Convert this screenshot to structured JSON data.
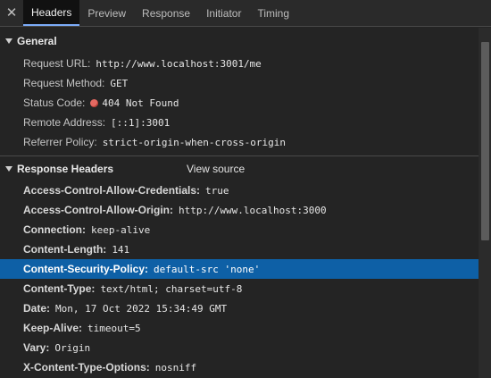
{
  "tabs": [
    {
      "label": "Headers",
      "active": true
    },
    {
      "label": "Preview",
      "active": false
    },
    {
      "label": "Response",
      "active": false
    },
    {
      "label": "Initiator",
      "active": false
    },
    {
      "label": "Timing",
      "active": false
    }
  ],
  "close_glyph": "✕",
  "general": {
    "title": "General",
    "request_url_label": "Request URL:",
    "request_url": "http://www.localhost:3001/me",
    "request_method_label": "Request Method:",
    "request_method": "GET",
    "status_code_label": "Status Code:",
    "status_code": "404 Not Found",
    "status_color": "#e46962",
    "remote_address_label": "Remote Address:",
    "remote_address": "[::1]:3001",
    "referrer_policy_label": "Referrer Policy:",
    "referrer_policy": "strict-origin-when-cross-origin"
  },
  "response_headers": {
    "title": "Response Headers",
    "view_source_label": "View source",
    "items": [
      {
        "name": "Access-Control-Allow-Credentials:",
        "value": "true"
      },
      {
        "name": "Access-Control-Allow-Origin:",
        "value": "http://www.localhost:3000"
      },
      {
        "name": "Connection:",
        "value": "keep-alive"
      },
      {
        "name": "Content-Length:",
        "value": "141"
      },
      {
        "name": "Content-Security-Policy:",
        "value": "default-src 'none'"
      },
      {
        "name": "Content-Type:",
        "value": "text/html; charset=utf-8"
      },
      {
        "name": "Date:",
        "value": "Mon, 17 Oct 2022 15:34:49 GMT"
      },
      {
        "name": "Keep-Alive:",
        "value": "timeout=5"
      },
      {
        "name": "Vary:",
        "value": "Origin"
      },
      {
        "name": "X-Content-Type-Options:",
        "value": "nosniff"
      }
    ]
  },
  "selection_color": "#0e60a6",
  "accent_color": "#7cacf8"
}
